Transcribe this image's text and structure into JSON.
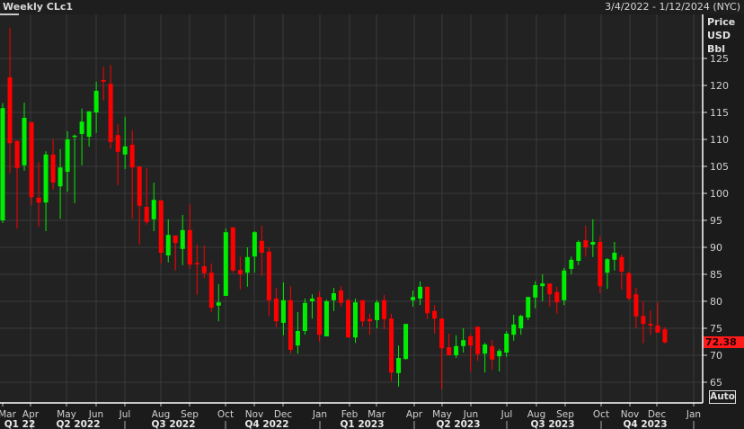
{
  "header": {
    "title": "Weekly CLc1",
    "range": "3/4/2022 - 1/12/2024 (NYC)"
  },
  "colors": {
    "up": "#00ee00",
    "down": "#ff0000",
    "background": "#222222",
    "grid": "#3a3a3a"
  },
  "auto_label": "Auto",
  "chart_data": {
    "type": "candlestick",
    "title": "Weekly CLc1",
    "ylabel_lines": [
      "Price",
      "USD",
      "Bbl"
    ],
    "ylim": [
      63,
      131
    ],
    "yticks": [
      65,
      70,
      75,
      80,
      85,
      90,
      95,
      100,
      105,
      110,
      115,
      120,
      125
    ],
    "grid": true,
    "last_price": "72.38",
    "month_labels": [
      "Mar",
      "Apr",
      "May",
      "Jun",
      "Jul",
      "Aug",
      "Sep",
      "Oct",
      "Nov",
      "Dec",
      "Jan",
      "Feb",
      "Mar",
      "Apr",
      "May",
      "Jun",
      "Jul",
      "Aug",
      "Sep",
      "Oct",
      "Nov",
      "Dec",
      "Jan"
    ],
    "quarter_labels": [
      "Q1 22",
      "Q2 2022",
      "Q3 2022",
      "Q4 2022",
      "Q1 2023",
      "Q2 2023",
      "Q3 2023",
      "Q4 2023"
    ],
    "ohlc_fields": [
      "open",
      "high",
      "low",
      "close"
    ],
    "candles": [
      [
        95,
        116.7,
        94.5,
        115.8
      ],
      [
        121.5,
        130.7,
        103.7,
        109.3
      ],
      [
        109.7,
        109.8,
        93.5,
        104.7
      ],
      [
        105.2,
        116.8,
        104.2,
        114
      ],
      [
        113.2,
        113.2,
        97.8,
        99.3
      ],
      [
        99.2,
        105.8,
        93.8,
        98.3
      ],
      [
        98.3,
        107.8,
        93,
        107.2
      ],
      [
        107.2,
        110,
        100.7,
        102
      ],
      [
        101.3,
        108.2,
        95.3,
        104.8
      ],
      [
        104,
        111.5,
        100.3,
        110
      ],
      [
        110.5,
        110.9,
        98.2,
        110.7
      ],
      [
        111,
        115.7,
        105.2,
        113.3
      ],
      [
        110.5,
        115.2,
        108.7,
        115.2
      ],
      [
        115,
        120.7,
        111.2,
        119
      ],
      [
        121,
        123.5,
        117.2,
        120.7
      ],
      [
        120.3,
        123.8,
        108.3,
        109.5
      ],
      [
        110.8,
        112.8,
        101.5,
        107.7
      ],
      [
        107.2,
        114.2,
        104.5,
        108.7
      ],
      [
        109,
        111.7,
        95.3,
        104.8
      ],
      [
        105,
        105,
        90.5,
        97.7
      ],
      [
        97.5,
        104.7,
        94.2,
        94.7
      ],
      [
        95.2,
        102,
        93,
        98.8
      ],
      [
        98.7,
        98.7,
        87,
        89
      ],
      [
        88.5,
        95.2,
        87.2,
        92.3
      ],
      [
        92.2,
        92.2,
        85.7,
        90.8
      ],
      [
        89.7,
        96,
        86.7,
        93.2
      ],
      [
        93.2,
        98,
        86,
        86.8
      ],
      [
        87.1,
        90.5,
        81.2,
        87
      ],
      [
        86.5,
        90.3,
        84.3,
        85.2
      ],
      [
        85.3,
        87,
        78,
        78.8
      ],
      [
        79.2,
        83.2,
        76.3,
        79.8
      ],
      [
        81,
        93.5,
        81,
        92.8
      ],
      [
        93.7,
        93.7,
        85.3,
        85.7
      ],
      [
        85.8,
        88.3,
        82.2,
        85
      ],
      [
        85.3,
        90,
        82.7,
        88.2
      ],
      [
        88.3,
        93,
        85.3,
        92.8
      ],
      [
        91.2,
        94,
        84.7,
        89
      ],
      [
        89.2,
        90,
        77.3,
        80.2
      ],
      [
        80.5,
        82.5,
        75.2,
        76.3
      ],
      [
        76,
        83.5,
        73.7,
        80.2
      ],
      [
        80.2,
        82.8,
        70.3,
        71
      ],
      [
        71.8,
        78,
        70.3,
        74.5
      ],
      [
        74.5,
        80.5,
        73.8,
        79.7
      ],
      [
        80,
        81.3,
        76.8,
        80.5
      ],
      [
        80.8,
        81.8,
        72.5,
        73.8
      ],
      [
        73.5,
        80.3,
        73.5,
        80
      ],
      [
        80.2,
        82.5,
        78.2,
        81.5
      ],
      [
        82,
        82.8,
        79,
        79.7
      ],
      [
        80.2,
        80.5,
        73.3,
        73.3
      ],
      [
        73.3,
        80.5,
        72.3,
        79.8
      ],
      [
        80.2,
        80.2,
        75.3,
        76.3
      ],
      [
        76.7,
        77.7,
        73.8,
        76.3
      ],
      [
        76.5,
        80.2,
        75,
        79.8
      ],
      [
        80.2,
        81.2,
        74.8,
        76.7
      ],
      [
        76.8,
        77.7,
        65.2,
        66.8
      ],
      [
        66.7,
        71.8,
        64.2,
        69.5
      ],
      [
        69.3,
        75.8,
        69.2,
        75.8
      ],
      [
        80.2,
        82,
        79,
        80.8
      ],
      [
        80.5,
        83.7,
        79.3,
        82.7
      ],
      [
        82.7,
        82.7,
        76.7,
        77.8
      ],
      [
        78.2,
        79.3,
        74,
        76.8
      ],
      [
        76.8,
        76.8,
        63.7,
        71.3
      ],
      [
        71.5,
        74,
        70,
        70
      ],
      [
        70,
        73.7,
        69.5,
        71.7
      ],
      [
        71.7,
        75,
        70.5,
        72.8
      ],
      [
        73.5,
        74,
        67,
        71.8
      ],
      [
        75.3,
        75.3,
        69,
        70.2
      ],
      [
        70.3,
        72.3,
        66.8,
        72
      ],
      [
        71.7,
        72.8,
        67.3,
        69.2
      ],
      [
        69.8,
        71.2,
        67,
        70.8
      ],
      [
        70.5,
        74.5,
        69.7,
        74
      ],
      [
        73.8,
        77.5,
        72.7,
        75.7
      ],
      [
        75,
        77.5,
        73.8,
        77.3
      ],
      [
        77,
        80.8,
        76.5,
        80.8
      ],
      [
        80.7,
        83.7,
        78.7,
        83
      ],
      [
        82.8,
        85,
        80,
        83.3
      ],
      [
        83.3,
        83.3,
        79,
        81.3
      ],
      [
        81.7,
        82.7,
        77.7,
        79.8
      ],
      [
        80.2,
        86.2,
        79.3,
        85.7
      ],
      [
        86,
        88.3,
        85,
        87.7
      ],
      [
        87.5,
        91.3,
        86.7,
        91
      ],
      [
        91.3,
        94,
        88.3,
        90
      ],
      [
        90.5,
        95.2,
        88.2,
        91
      ],
      [
        91,
        92,
        81.5,
        82.8
      ],
      [
        85.3,
        88,
        82.3,
        87.8
      ],
      [
        87.7,
        91,
        85.7,
        89
      ],
      [
        88.2,
        88.7,
        82.2,
        85.5
      ],
      [
        85.2,
        85.5,
        80.2,
        80.5
      ],
      [
        81.3,
        82.5,
        75,
        77.2
      ],
      [
        77.3,
        80,
        72.2,
        75.8
      ],
      [
        75.8,
        78.3,
        73.8,
        75.5
      ],
      [
        75.5,
        79.8,
        74.2,
        74.2
      ],
      [
        74.8,
        75.2,
        72.2,
        72.38
      ]
    ]
  }
}
